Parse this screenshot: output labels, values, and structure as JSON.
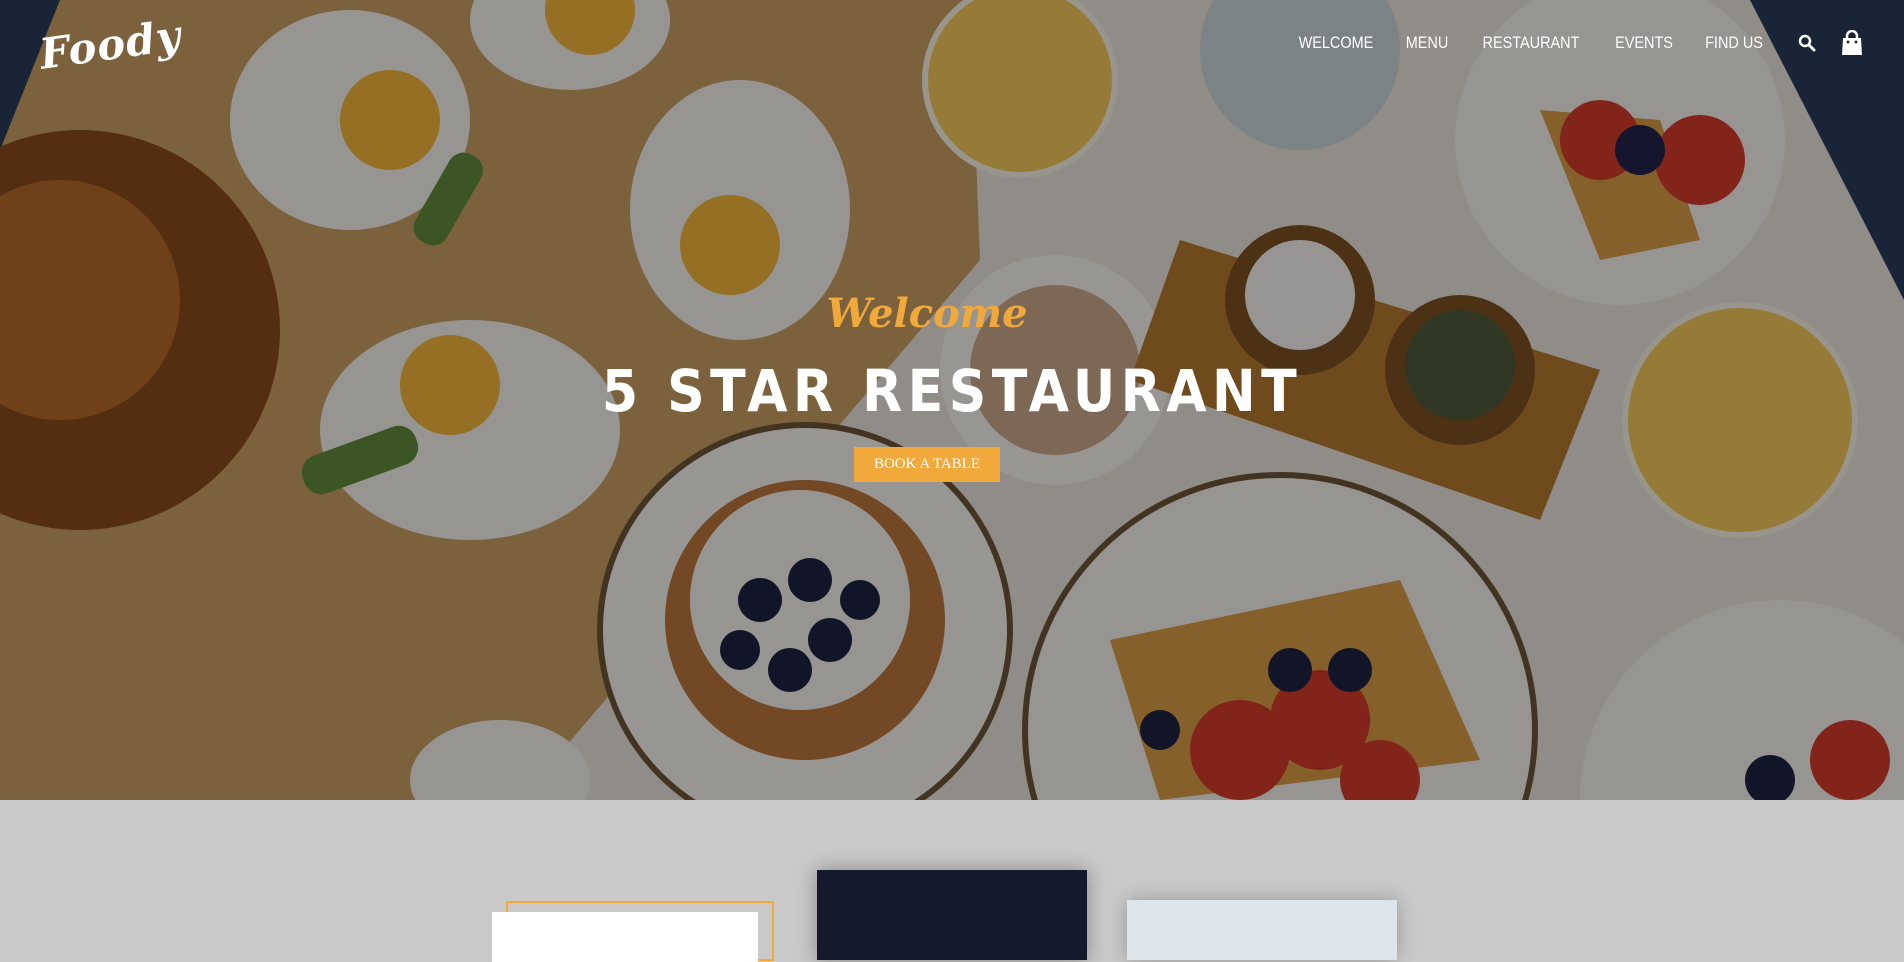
{
  "brand": {
    "logo_text": "Foody"
  },
  "nav": {
    "items": [
      "WELCOME",
      "MENU",
      "RESTAURANT",
      "EVENTS",
      "FIND US"
    ],
    "search_icon": "search-icon",
    "cart_icon": "shopping-bag-icon"
  },
  "hero": {
    "welcome": "Welcome",
    "title": "5 STAR RESTAURANT",
    "book_button": "BOOK A TABLE"
  },
  "colors": {
    "accent": "#f2a93b",
    "section_bg": "#c9c9c9"
  }
}
